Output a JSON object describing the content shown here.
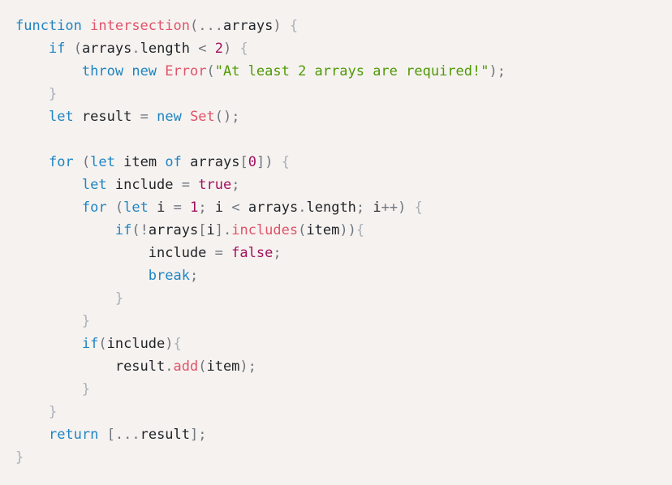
{
  "editor": {
    "background_color": "#f6f2ef",
    "language": "JavaScript",
    "font_size_px": 17,
    "line_height_px": 28
  },
  "theme": {
    "keyword": "#1e85c4",
    "function": "#e0536b",
    "identifier": "#1f2328",
    "string": "#4e9a06",
    "number": "#a0105e",
    "constant": "#a0105e",
    "punctuation": "#6f7680",
    "brace": "#a8b0ba",
    "background": "#f6f2ef"
  },
  "code": {
    "plain_text": "function intersection(...arrays) {\n    if (arrays.length < 2) {\n        throw new Error(\"At least 2 arrays are required!\");\n    }\n    let result = new Set();\n\n    for (let item of arrays[0]) {\n        let include = true;\n        for (let i = 1; i < arrays.length; i++) {\n            if(!arrays[i].includes(item)){\n                include = false;\n                break;\n            }\n        }\n        if(include){\n            result.add(item);\n        }\n    }\n    return [...result];\n}",
    "lines": [
      {
        "indent": 0,
        "tokens": [
          {
            "text": "function",
            "kind": "keyword"
          },
          {
            "text": " ",
            "kind": "plain"
          },
          {
            "text": "intersection",
            "kind": "function"
          },
          {
            "text": "(",
            "kind": "punct"
          },
          {
            "text": "...",
            "kind": "punct"
          },
          {
            "text": "arrays",
            "kind": "ident"
          },
          {
            "text": ")",
            "kind": "punct"
          },
          {
            "text": " ",
            "kind": "plain"
          },
          {
            "text": "{",
            "kind": "brace"
          }
        ]
      },
      {
        "indent": 1,
        "tokens": [
          {
            "text": "if",
            "kind": "control"
          },
          {
            "text": " ",
            "kind": "plain"
          },
          {
            "text": "(",
            "kind": "punct"
          },
          {
            "text": "arrays",
            "kind": "ident"
          },
          {
            "text": ".",
            "kind": "punct"
          },
          {
            "text": "length",
            "kind": "property"
          },
          {
            "text": " ",
            "kind": "plain"
          },
          {
            "text": "<",
            "kind": "operator"
          },
          {
            "text": " ",
            "kind": "plain"
          },
          {
            "text": "2",
            "kind": "number"
          },
          {
            "text": ")",
            "kind": "punct"
          },
          {
            "text": " ",
            "kind": "plain"
          },
          {
            "text": "{",
            "kind": "brace"
          }
        ]
      },
      {
        "indent": 2,
        "tokens": [
          {
            "text": "throw",
            "kind": "control"
          },
          {
            "text": " ",
            "kind": "plain"
          },
          {
            "text": "new",
            "kind": "keyword"
          },
          {
            "text": " ",
            "kind": "plain"
          },
          {
            "text": "Error",
            "kind": "class"
          },
          {
            "text": "(",
            "kind": "punct"
          },
          {
            "text": "\"At least 2 arrays are required!\"",
            "kind": "string"
          },
          {
            "text": ")",
            "kind": "punct"
          },
          {
            "text": ";",
            "kind": "punct"
          }
        ]
      },
      {
        "indent": 1,
        "tokens": [
          {
            "text": "}",
            "kind": "brace"
          }
        ]
      },
      {
        "indent": 1,
        "tokens": [
          {
            "text": "let",
            "kind": "declaration"
          },
          {
            "text": " ",
            "kind": "plain"
          },
          {
            "text": "result",
            "kind": "ident"
          },
          {
            "text": " ",
            "kind": "plain"
          },
          {
            "text": "=",
            "kind": "operator"
          },
          {
            "text": " ",
            "kind": "plain"
          },
          {
            "text": "new",
            "kind": "keyword"
          },
          {
            "text": " ",
            "kind": "plain"
          },
          {
            "text": "Set",
            "kind": "class"
          },
          {
            "text": "(",
            "kind": "punct"
          },
          {
            "text": ")",
            "kind": "punct"
          },
          {
            "text": ";",
            "kind": "punct"
          }
        ]
      },
      {
        "indent": 0,
        "tokens": []
      },
      {
        "indent": 1,
        "tokens": [
          {
            "text": "for",
            "kind": "control"
          },
          {
            "text": " ",
            "kind": "plain"
          },
          {
            "text": "(",
            "kind": "punct"
          },
          {
            "text": "let",
            "kind": "declaration"
          },
          {
            "text": " ",
            "kind": "plain"
          },
          {
            "text": "item",
            "kind": "ident"
          },
          {
            "text": " ",
            "kind": "plain"
          },
          {
            "text": "of",
            "kind": "keyword"
          },
          {
            "text": " ",
            "kind": "plain"
          },
          {
            "text": "arrays",
            "kind": "ident"
          },
          {
            "text": "[",
            "kind": "punct"
          },
          {
            "text": "0",
            "kind": "number"
          },
          {
            "text": "]",
            "kind": "punct"
          },
          {
            "text": ")",
            "kind": "punct"
          },
          {
            "text": " ",
            "kind": "plain"
          },
          {
            "text": "{",
            "kind": "brace"
          }
        ]
      },
      {
        "indent": 2,
        "tokens": [
          {
            "text": "let",
            "kind": "declaration"
          },
          {
            "text": " ",
            "kind": "plain"
          },
          {
            "text": "include",
            "kind": "ident"
          },
          {
            "text": " ",
            "kind": "plain"
          },
          {
            "text": "=",
            "kind": "operator"
          },
          {
            "text": " ",
            "kind": "plain"
          },
          {
            "text": "true",
            "kind": "constant"
          },
          {
            "text": ";",
            "kind": "punct"
          }
        ]
      },
      {
        "indent": 2,
        "tokens": [
          {
            "text": "for",
            "kind": "control"
          },
          {
            "text": " ",
            "kind": "plain"
          },
          {
            "text": "(",
            "kind": "punct"
          },
          {
            "text": "let",
            "kind": "declaration"
          },
          {
            "text": " ",
            "kind": "plain"
          },
          {
            "text": "i",
            "kind": "ident"
          },
          {
            "text": " ",
            "kind": "plain"
          },
          {
            "text": "=",
            "kind": "operator"
          },
          {
            "text": " ",
            "kind": "plain"
          },
          {
            "text": "1",
            "kind": "number"
          },
          {
            "text": ";",
            "kind": "punct"
          },
          {
            "text": " ",
            "kind": "plain"
          },
          {
            "text": "i",
            "kind": "ident"
          },
          {
            "text": " ",
            "kind": "plain"
          },
          {
            "text": "<",
            "kind": "operator"
          },
          {
            "text": " ",
            "kind": "plain"
          },
          {
            "text": "arrays",
            "kind": "ident"
          },
          {
            "text": ".",
            "kind": "punct"
          },
          {
            "text": "length",
            "kind": "property"
          },
          {
            "text": ";",
            "kind": "punct"
          },
          {
            "text": " ",
            "kind": "plain"
          },
          {
            "text": "i",
            "kind": "ident"
          },
          {
            "text": "++",
            "kind": "operator"
          },
          {
            "text": ")",
            "kind": "punct"
          },
          {
            "text": " ",
            "kind": "plain"
          },
          {
            "text": "{",
            "kind": "brace"
          }
        ]
      },
      {
        "indent": 3,
        "tokens": [
          {
            "text": "if",
            "kind": "control"
          },
          {
            "text": "(",
            "kind": "punct"
          },
          {
            "text": "!",
            "kind": "operator"
          },
          {
            "text": "arrays",
            "kind": "ident"
          },
          {
            "text": "[",
            "kind": "punct"
          },
          {
            "text": "i",
            "kind": "ident"
          },
          {
            "text": "]",
            "kind": "punct"
          },
          {
            "text": ".",
            "kind": "punct"
          },
          {
            "text": "includes",
            "kind": "method"
          },
          {
            "text": "(",
            "kind": "punct"
          },
          {
            "text": "item",
            "kind": "ident"
          },
          {
            "text": ")",
            "kind": "punct"
          },
          {
            "text": ")",
            "kind": "punct"
          },
          {
            "text": "{",
            "kind": "brace"
          }
        ]
      },
      {
        "indent": 4,
        "tokens": [
          {
            "text": "include",
            "kind": "ident"
          },
          {
            "text": " ",
            "kind": "plain"
          },
          {
            "text": "=",
            "kind": "operator"
          },
          {
            "text": " ",
            "kind": "plain"
          },
          {
            "text": "false",
            "kind": "constant"
          },
          {
            "text": ";",
            "kind": "punct"
          }
        ]
      },
      {
        "indent": 4,
        "tokens": [
          {
            "text": "break",
            "kind": "control"
          },
          {
            "text": ";",
            "kind": "punct"
          }
        ]
      },
      {
        "indent": 3,
        "tokens": [
          {
            "text": "}",
            "kind": "brace"
          }
        ]
      },
      {
        "indent": 2,
        "tokens": [
          {
            "text": "}",
            "kind": "brace"
          }
        ]
      },
      {
        "indent": 2,
        "tokens": [
          {
            "text": "if",
            "kind": "control"
          },
          {
            "text": "(",
            "kind": "punct"
          },
          {
            "text": "include",
            "kind": "ident"
          },
          {
            "text": ")",
            "kind": "punct"
          },
          {
            "text": "{",
            "kind": "brace"
          }
        ]
      },
      {
        "indent": 3,
        "tokens": [
          {
            "text": "result",
            "kind": "ident"
          },
          {
            "text": ".",
            "kind": "punct"
          },
          {
            "text": "add",
            "kind": "method"
          },
          {
            "text": "(",
            "kind": "punct"
          },
          {
            "text": "item",
            "kind": "ident"
          },
          {
            "text": ")",
            "kind": "punct"
          },
          {
            "text": ";",
            "kind": "punct"
          }
        ]
      },
      {
        "indent": 2,
        "tokens": [
          {
            "text": "}",
            "kind": "brace"
          }
        ]
      },
      {
        "indent": 1,
        "tokens": [
          {
            "text": "}",
            "kind": "brace"
          }
        ]
      },
      {
        "indent": 1,
        "tokens": [
          {
            "text": "return",
            "kind": "control"
          },
          {
            "text": " ",
            "kind": "plain"
          },
          {
            "text": "[",
            "kind": "punct"
          },
          {
            "text": "...",
            "kind": "punct"
          },
          {
            "text": "result",
            "kind": "ident"
          },
          {
            "text": "]",
            "kind": "punct"
          },
          {
            "text": ";",
            "kind": "punct"
          }
        ]
      },
      {
        "indent": 0,
        "tokens": [
          {
            "text": "}",
            "kind": "brace"
          }
        ]
      }
    ]
  }
}
